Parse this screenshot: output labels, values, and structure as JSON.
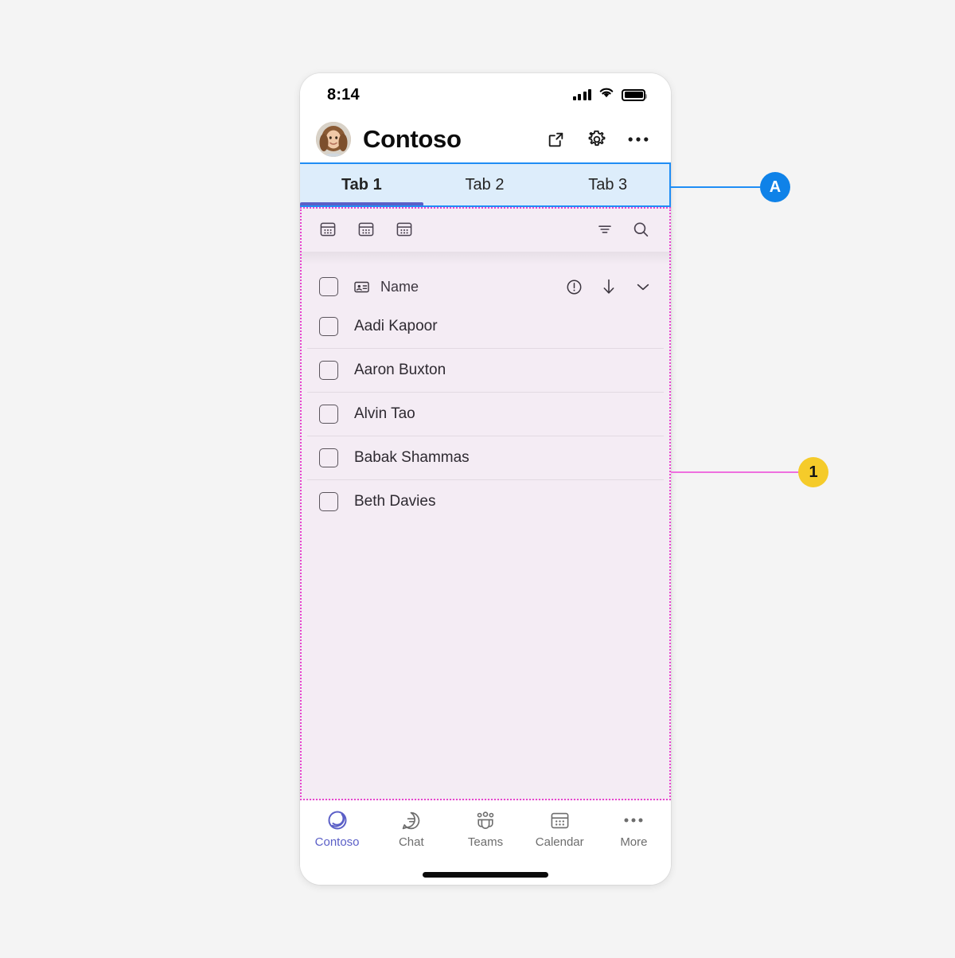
{
  "statusbar": {
    "time": "8:14",
    "signal_icon": "cellular-signal-icon",
    "wifi_icon": "wifi-icon",
    "battery_icon": "battery-full-icon"
  },
  "appbar": {
    "avatar_name": "user-avatar",
    "title": "Contoso",
    "actions": [
      {
        "name": "open-in-new-window-button",
        "icon": "external-link-icon"
      },
      {
        "name": "settings-button",
        "icon": "gear-icon"
      },
      {
        "name": "more-options-button",
        "icon": "ellipsis-icon"
      }
    ]
  },
  "tabs": [
    {
      "label": "Tab 1",
      "active": true
    },
    {
      "label": "Tab 2",
      "active": false
    },
    {
      "label": "Tab 3",
      "active": false
    }
  ],
  "toolbar": {
    "left_icons": [
      {
        "name": "grid-view-button-1",
        "icon": "calendar-grid-icon"
      },
      {
        "name": "grid-view-button-2",
        "icon": "calendar-grid-icon"
      },
      {
        "name": "grid-view-button-3",
        "icon": "calendar-grid-icon"
      }
    ],
    "right_icons": [
      {
        "name": "filter-button",
        "icon": "filter-icon"
      },
      {
        "name": "search-button",
        "icon": "search-icon"
      }
    ]
  },
  "list": {
    "header": {
      "select_all_name": "select-all-checkbox",
      "column_icon": "contact-card-icon",
      "column_label": "Name",
      "actions": [
        {
          "name": "required-column-button",
          "icon": "exclamation-circle-icon"
        },
        {
          "name": "sort-descending-button",
          "icon": "arrow-down-icon"
        },
        {
          "name": "column-options-button",
          "icon": "chevron-down-icon"
        }
      ]
    },
    "rows": [
      {
        "name": "Aadi Kapoor"
      },
      {
        "name": "Aaron Buxton"
      },
      {
        "name": "Alvin Tao"
      },
      {
        "name": "Babak Shammas"
      },
      {
        "name": "Beth Davies"
      }
    ]
  },
  "bottomnav": [
    {
      "label": "Contoso",
      "icon": "contoso-logo-icon",
      "active": true
    },
    {
      "label": "Chat",
      "icon": "chat-bubble-icon",
      "active": false
    },
    {
      "label": "Teams",
      "icon": "teams-people-icon",
      "active": false
    },
    {
      "label": "Calendar",
      "icon": "calendar-icon",
      "active": false
    },
    {
      "label": "More",
      "icon": "ellipsis-icon",
      "active": false
    }
  ],
  "callouts": [
    {
      "label": "A",
      "style": "blue",
      "target": "tab-strip"
    },
    {
      "label": "1",
      "style": "yellow",
      "target": "content-region"
    }
  ],
  "colors": {
    "accent_blue": "#1f8df5",
    "tab_background": "#ddedfb",
    "tab_indicator": "#5b5fc7",
    "content_background": "#f4ecf4",
    "outline_magenta": "#e845cf",
    "callout_pink": "#ee6fdf",
    "badge_blue": "#0f82e8",
    "badge_yellow": "#f5cb2a",
    "page_background": "#f4f4f4"
  }
}
